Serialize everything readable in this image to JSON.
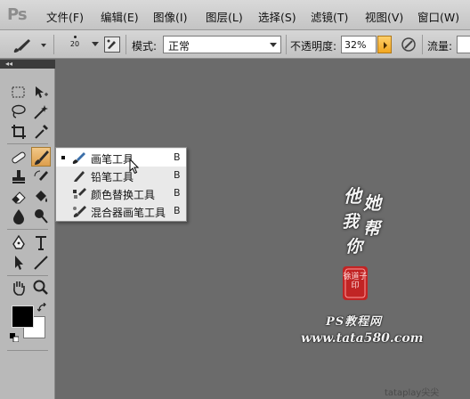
{
  "app": {
    "logo": "Ps"
  },
  "menu": [
    {
      "id": "file",
      "label": "文件(F)"
    },
    {
      "id": "edit",
      "label": "编辑(E)"
    },
    {
      "id": "image",
      "label": "图像(I)"
    },
    {
      "id": "layer",
      "label": "图层(L)"
    },
    {
      "id": "select",
      "label": "选择(S)"
    },
    {
      "id": "filter",
      "label": "滤镜(T)"
    },
    {
      "id": "view",
      "label": "视图(V)"
    },
    {
      "id": "window",
      "label": "窗口(W)"
    }
  ],
  "options": {
    "brush_size": "20",
    "mode_label": "模式:",
    "mode_value": "正常",
    "opacity_label": "不透明度:",
    "opacity_value": "32%",
    "flow_label": "流量:"
  },
  "toolbox": {
    "collapse_glyph": "◂◂"
  },
  "flyout": {
    "items": [
      {
        "label": "画笔工具",
        "shortcut": "B",
        "selected": true,
        "icon": "brush-icon"
      },
      {
        "label": "铅笔工具",
        "shortcut": "B",
        "selected": false,
        "icon": "pencil-icon"
      },
      {
        "label": "颜色替换工具",
        "shortcut": "B",
        "selected": false,
        "icon": "color-replacement-icon"
      },
      {
        "label": "混合器画笔工具",
        "shortcut": "B",
        "selected": false,
        "icon": "mixer-brush-icon"
      }
    ]
  },
  "canvas": {
    "calligraphy": [
      "他",
      "她",
      "我",
      "帮",
      "你"
    ],
    "seal": "徐道子印",
    "site_name": "PS教程网",
    "site_url": "www.tata580.com",
    "corner_mark": "tataplay尖尖"
  },
  "colors": {
    "foreground": "#000000",
    "background": "#ffffff",
    "workspace": "#6b6b6b",
    "active_tool": "#e3a955"
  }
}
